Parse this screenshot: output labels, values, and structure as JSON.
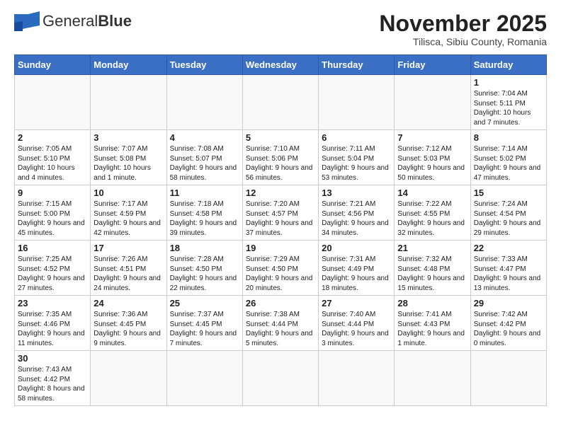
{
  "header": {
    "logo_general": "General",
    "logo_blue": "Blue",
    "month_title": "November 2025",
    "subtitle": "Tilisca, Sibiu County, Romania"
  },
  "weekdays": [
    "Sunday",
    "Monday",
    "Tuesday",
    "Wednesday",
    "Thursday",
    "Friday",
    "Saturday"
  ],
  "weeks": [
    [
      {
        "day": "",
        "info": ""
      },
      {
        "day": "",
        "info": ""
      },
      {
        "day": "",
        "info": ""
      },
      {
        "day": "",
        "info": ""
      },
      {
        "day": "",
        "info": ""
      },
      {
        "day": "",
        "info": ""
      },
      {
        "day": "1",
        "info": "Sunrise: 7:04 AM\nSunset: 5:11 PM\nDaylight: 10 hours and 7 minutes."
      }
    ],
    [
      {
        "day": "2",
        "info": "Sunrise: 7:05 AM\nSunset: 5:10 PM\nDaylight: 10 hours and 4 minutes."
      },
      {
        "day": "3",
        "info": "Sunrise: 7:07 AM\nSunset: 5:08 PM\nDaylight: 10 hours and 1 minute."
      },
      {
        "day": "4",
        "info": "Sunrise: 7:08 AM\nSunset: 5:07 PM\nDaylight: 9 hours and 58 minutes."
      },
      {
        "day": "5",
        "info": "Sunrise: 7:10 AM\nSunset: 5:06 PM\nDaylight: 9 hours and 56 minutes."
      },
      {
        "day": "6",
        "info": "Sunrise: 7:11 AM\nSunset: 5:04 PM\nDaylight: 9 hours and 53 minutes."
      },
      {
        "day": "7",
        "info": "Sunrise: 7:12 AM\nSunset: 5:03 PM\nDaylight: 9 hours and 50 minutes."
      },
      {
        "day": "8",
        "info": "Sunrise: 7:14 AM\nSunset: 5:02 PM\nDaylight: 9 hours and 47 minutes."
      }
    ],
    [
      {
        "day": "9",
        "info": "Sunrise: 7:15 AM\nSunset: 5:00 PM\nDaylight: 9 hours and 45 minutes."
      },
      {
        "day": "10",
        "info": "Sunrise: 7:17 AM\nSunset: 4:59 PM\nDaylight: 9 hours and 42 minutes."
      },
      {
        "day": "11",
        "info": "Sunrise: 7:18 AM\nSunset: 4:58 PM\nDaylight: 9 hours and 39 minutes."
      },
      {
        "day": "12",
        "info": "Sunrise: 7:20 AM\nSunset: 4:57 PM\nDaylight: 9 hours and 37 minutes."
      },
      {
        "day": "13",
        "info": "Sunrise: 7:21 AM\nSunset: 4:56 PM\nDaylight: 9 hours and 34 minutes."
      },
      {
        "day": "14",
        "info": "Sunrise: 7:22 AM\nSunset: 4:55 PM\nDaylight: 9 hours and 32 minutes."
      },
      {
        "day": "15",
        "info": "Sunrise: 7:24 AM\nSunset: 4:54 PM\nDaylight: 9 hours and 29 minutes."
      }
    ],
    [
      {
        "day": "16",
        "info": "Sunrise: 7:25 AM\nSunset: 4:52 PM\nDaylight: 9 hours and 27 minutes."
      },
      {
        "day": "17",
        "info": "Sunrise: 7:26 AM\nSunset: 4:51 PM\nDaylight: 9 hours and 24 minutes."
      },
      {
        "day": "18",
        "info": "Sunrise: 7:28 AM\nSunset: 4:50 PM\nDaylight: 9 hours and 22 minutes."
      },
      {
        "day": "19",
        "info": "Sunrise: 7:29 AM\nSunset: 4:50 PM\nDaylight: 9 hours and 20 minutes."
      },
      {
        "day": "20",
        "info": "Sunrise: 7:31 AM\nSunset: 4:49 PM\nDaylight: 9 hours and 18 minutes."
      },
      {
        "day": "21",
        "info": "Sunrise: 7:32 AM\nSunset: 4:48 PM\nDaylight: 9 hours and 15 minutes."
      },
      {
        "day": "22",
        "info": "Sunrise: 7:33 AM\nSunset: 4:47 PM\nDaylight: 9 hours and 13 minutes."
      }
    ],
    [
      {
        "day": "23",
        "info": "Sunrise: 7:35 AM\nSunset: 4:46 PM\nDaylight: 9 hours and 11 minutes."
      },
      {
        "day": "24",
        "info": "Sunrise: 7:36 AM\nSunset: 4:45 PM\nDaylight: 9 hours and 9 minutes."
      },
      {
        "day": "25",
        "info": "Sunrise: 7:37 AM\nSunset: 4:45 PM\nDaylight: 9 hours and 7 minutes."
      },
      {
        "day": "26",
        "info": "Sunrise: 7:38 AM\nSunset: 4:44 PM\nDaylight: 9 hours and 5 minutes."
      },
      {
        "day": "27",
        "info": "Sunrise: 7:40 AM\nSunset: 4:44 PM\nDaylight: 9 hours and 3 minutes."
      },
      {
        "day": "28",
        "info": "Sunrise: 7:41 AM\nSunset: 4:43 PM\nDaylight: 9 hours and 1 minute."
      },
      {
        "day": "29",
        "info": "Sunrise: 7:42 AM\nSunset: 4:42 PM\nDaylight: 9 hours and 0 minutes."
      }
    ],
    [
      {
        "day": "30",
        "info": "Sunrise: 7:43 AM\nSunset: 4:42 PM\nDaylight: 8 hours and 58 minutes."
      },
      {
        "day": "",
        "info": ""
      },
      {
        "day": "",
        "info": ""
      },
      {
        "day": "",
        "info": ""
      },
      {
        "day": "",
        "info": ""
      },
      {
        "day": "",
        "info": ""
      },
      {
        "day": "",
        "info": ""
      }
    ]
  ]
}
